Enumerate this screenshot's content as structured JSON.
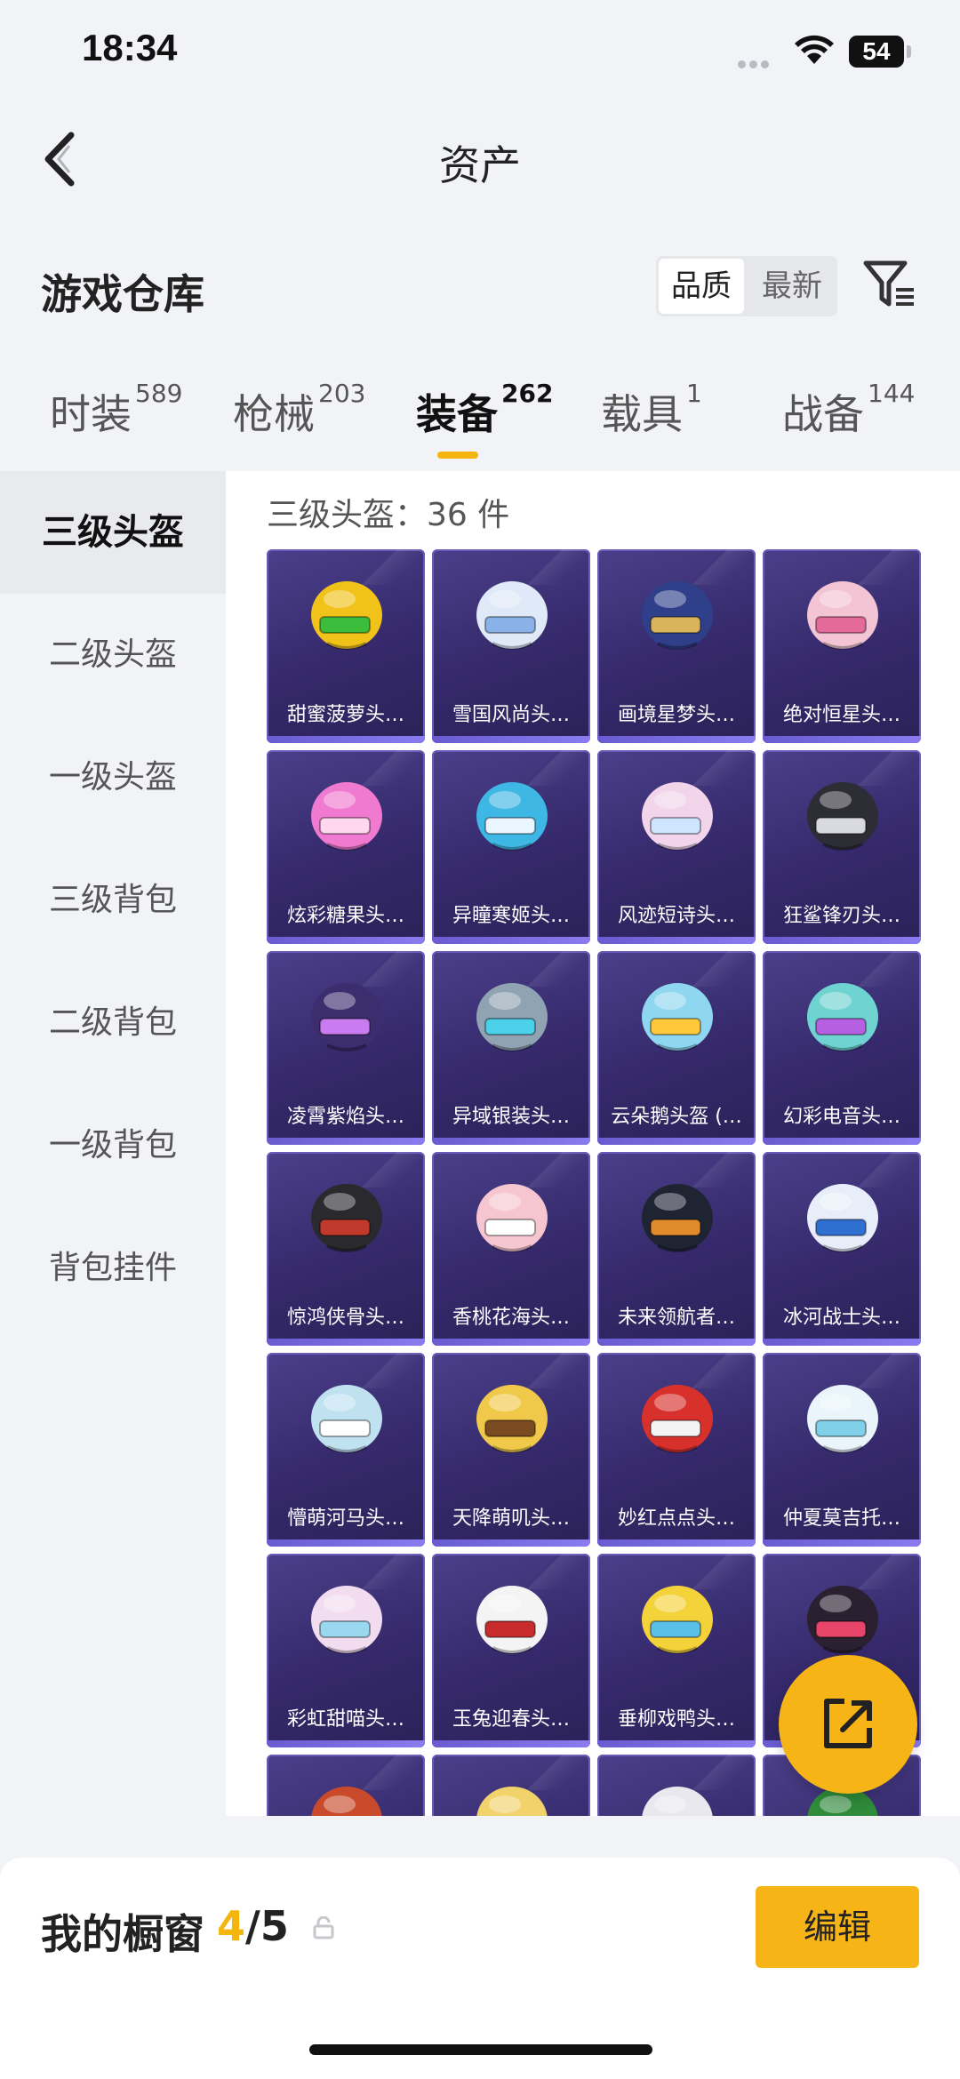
{
  "status_bar": {
    "time": "18:34",
    "battery": "54"
  },
  "nav": {
    "title": "资产"
  },
  "warehouse": {
    "title": "游戏仓库",
    "sort_options": [
      "品质",
      "最新"
    ],
    "active_sort": "品质"
  },
  "tabs": [
    {
      "label": "时装",
      "count": "589"
    },
    {
      "label": "枪械",
      "count": "203"
    },
    {
      "label": "装备",
      "count": "262",
      "active": true
    },
    {
      "label": "载具",
      "count": "1"
    },
    {
      "label": "战备",
      "count": "144"
    }
  ],
  "sidebar": {
    "items": [
      "三级头盔",
      "二级头盔",
      "一级头盔",
      "三级背包",
      "二级背包",
      "一级背包",
      "背包挂件"
    ],
    "active": "三级头盔"
  },
  "content": {
    "count_text": "三级头盔：36 件",
    "items": [
      {
        "name": "甜蜜菠萝头…",
        "color": "#f0c21a",
        "accent": "#3bbd3b"
      },
      {
        "name": "雪国风尚头…",
        "color": "#dfe9f7",
        "accent": "#8ab2e8"
      },
      {
        "name": "画境星梦头…",
        "color": "#2f3f8a",
        "accent": "#d9b45a"
      },
      {
        "name": "绝对恒星头…",
        "color": "#f3c4d3",
        "accent": "#e36a9a"
      },
      {
        "name": "炫彩糖果头…",
        "color": "#f07ad0",
        "accent": "#ffd8ef"
      },
      {
        "name": "异瞳寒姬头…",
        "color": "#3fb7e4",
        "accent": "#e9f6ff"
      },
      {
        "name": "风迹短诗头…",
        "color": "#f2d5ea",
        "accent": "#cfe4ff"
      },
      {
        "name": "狂鲨锋刃头…",
        "color": "#2d2d36",
        "accent": "#d9d9e0"
      },
      {
        "name": "凌霄紫焰头…",
        "color": "#3c2d6e",
        "accent": "#c87cf0"
      },
      {
        "name": "异域银装头…",
        "color": "#8fa3b3",
        "accent": "#4ad0e8"
      },
      {
        "name": "云朵鹅头盔 (…",
        "color": "#8fd6f0",
        "accent": "#ffc83a"
      },
      {
        "name": "幻彩电音头…",
        "color": "#6fd3d2",
        "accent": "#b65fe0"
      },
      {
        "name": "惊鸿侠骨头…",
        "color": "#2a2a2e",
        "accent": "#c0392b"
      },
      {
        "name": "香桃花海头…",
        "color": "#f5c6cf",
        "accent": "#ffffff"
      },
      {
        "name": "未来领航者…",
        "color": "#1f2433",
        "accent": "#e08a2c"
      },
      {
        "name": "冰河战士头…",
        "color": "#e8eef9",
        "accent": "#2e6fd0"
      },
      {
        "name": "懵萌河马头…",
        "color": "#bfe1f0",
        "accent": "#ffffff"
      },
      {
        "name": "天降萌叽头…",
        "color": "#f1c94a",
        "accent": "#7a4a20"
      },
      {
        "name": "妙红点点头…",
        "color": "#d8312b",
        "accent": "#f4f4f4"
      },
      {
        "name": "仲夏莫吉托…",
        "color": "#eaf4fb",
        "accent": "#7fd0e8"
      },
      {
        "name": "彩虹甜喵头…",
        "color": "#f2dcef",
        "accent": "#9ad8f0"
      },
      {
        "name": "玉兔迎春头…",
        "color": "#f4f4f4",
        "accent": "#c72b2b"
      },
      {
        "name": "垂柳戏鸭头…",
        "color": "#f4d23a",
        "accent": "#5ac0e8"
      },
      {
        "name": "",
        "color": "#2a2030",
        "accent": "#e8456a"
      },
      {
        "name": "",
        "color": "#c84a2a",
        "accent": "#f08a2a"
      },
      {
        "name": "",
        "color": "#f2d26a",
        "accent": "#ffffff"
      },
      {
        "name": "",
        "color": "#e8e8ee",
        "accent": "#f0c21a"
      },
      {
        "name": "",
        "color": "#2f8a3a",
        "accent": "#e8d04a"
      }
    ]
  },
  "showcase": {
    "title": "我的橱窗",
    "current": "4",
    "total": "/5",
    "edit_label": "编辑"
  }
}
